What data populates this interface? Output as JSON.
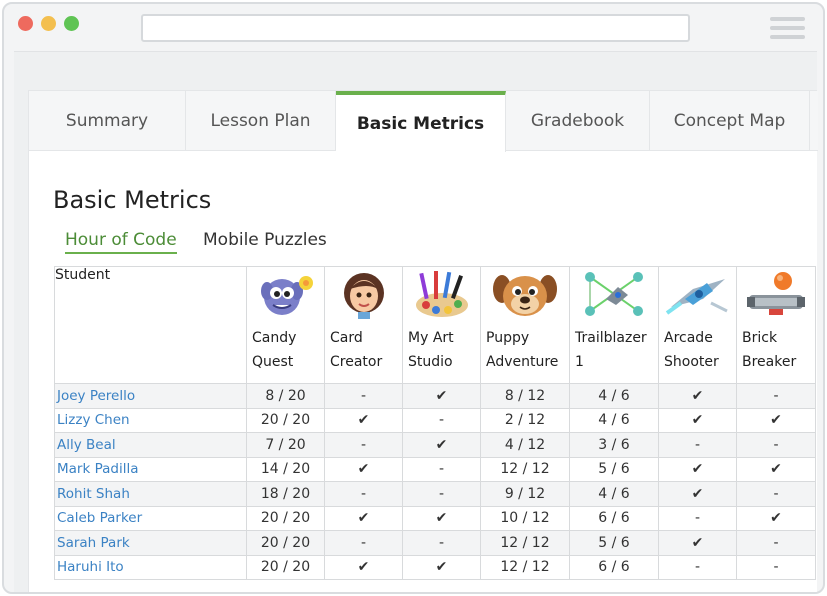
{
  "tabs": [
    {
      "label": "Summary",
      "active": false
    },
    {
      "label": "Lesson Plan",
      "active": false
    },
    {
      "label": "Basic Metrics",
      "active": true
    },
    {
      "label": "Gradebook",
      "active": false
    },
    {
      "label": "Concept Map",
      "active": false
    }
  ],
  "page_title": "Basic Metrics",
  "subtabs": [
    {
      "label": "Hour of Code",
      "active": true
    },
    {
      "label": "Mobile Puzzles",
      "active": false
    }
  ],
  "table": {
    "student_header": "Student",
    "columns": [
      {
        "line1": "Candy",
        "line2": "Quest",
        "icon": "candy-quest-icon"
      },
      {
        "line1": "Card",
        "line2": "Creator",
        "icon": "card-creator-icon"
      },
      {
        "line1": "My Art",
        "line2": "Studio",
        "icon": "my-art-studio-icon"
      },
      {
        "line1": "Puppy",
        "line2": "Adventure",
        "icon": "puppy-adventure-icon"
      },
      {
        "line1": "Trailblazer",
        "line2": "1",
        "icon": "trailblazer-icon"
      },
      {
        "line1": "Arcade",
        "line2": "Shooter",
        "icon": "arcade-shooter-icon"
      },
      {
        "line1": "Brick",
        "line2": "Breaker",
        "icon": "brick-breaker-icon"
      }
    ],
    "rows": [
      {
        "name": "Joey Perello",
        "cells": [
          "8 / 20",
          "-",
          "✔",
          "8 / 12",
          "4 / 6",
          "✔",
          "-"
        ]
      },
      {
        "name": "Lizzy Chen",
        "cells": [
          "20 / 20",
          "✔",
          "-",
          "2 / 12",
          "4 / 6",
          "✔",
          "✔"
        ]
      },
      {
        "name": "Ally Beal",
        "cells": [
          "7 /  20",
          "-",
          "✔",
          "4 / 12",
          "3 / 6",
          "-",
          "-"
        ]
      },
      {
        "name": "Mark Padilla",
        "cells": [
          "14 / 20",
          "✔",
          "-",
          "12 / 12",
          "5 / 6",
          "✔",
          "✔"
        ]
      },
      {
        "name": "Rohit Shah",
        "cells": [
          "18 / 20",
          "-",
          "-",
          "9 / 12",
          "4 / 6",
          "✔",
          "-"
        ]
      },
      {
        "name": "Caleb Parker",
        "cells": [
          "20 / 20",
          "✔",
          "✔",
          "10 / 12",
          "6 / 6",
          "-",
          "✔"
        ]
      },
      {
        "name": "Sarah Park",
        "cells": [
          "20 / 20",
          "-",
          "-",
          "12 / 12",
          "5 / 6",
          "✔",
          "-"
        ]
      },
      {
        "name": "Haruhi Ito",
        "cells": [
          "20 / 20",
          "✔",
          "✔",
          "12 / 12",
          "6 / 6",
          "-",
          "-"
        ]
      }
    ]
  },
  "colors": {
    "accent_green": "#6ab04c",
    "active_subtab_text": "#4c8c37",
    "link_blue": "#3b82c4",
    "check_green": "#4fae4f",
    "traffic_red": "#ee6a5e",
    "traffic_yellow": "#f3bf4f",
    "traffic_green": "#5fc454"
  }
}
